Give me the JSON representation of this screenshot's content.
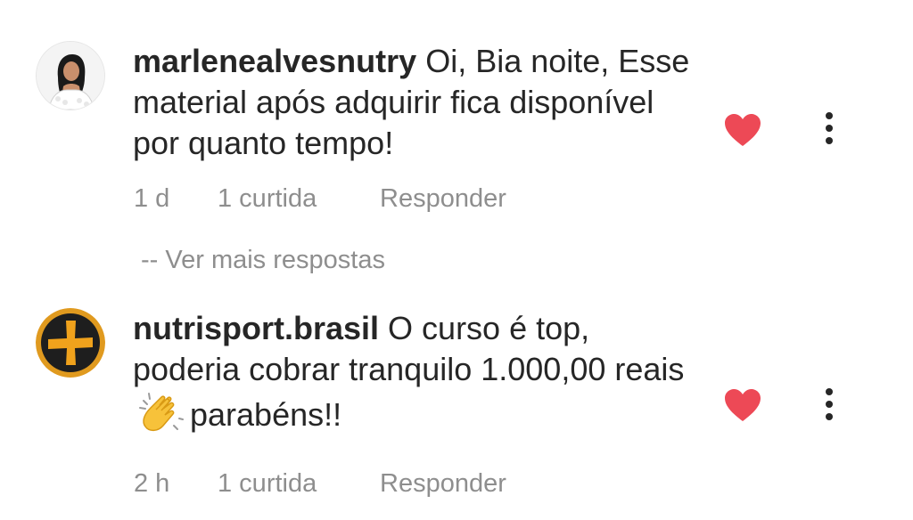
{
  "comments": [
    {
      "username": "marlenealvesnutry",
      "text": "Oi, Bia noite, Esse material após adquirir fica disponível por quanto tempo!",
      "time": "1 d",
      "likes": "1 curtida",
      "reply_label": "Responder",
      "avatar_icon": "profile-photo",
      "liked": true,
      "heart_color": "#ed4956"
    },
    {
      "username": "nutrisport.brasil",
      "text_before": "O curso é top, poderia cobrar tranquilo 1.000,00 reais",
      "text_after": "parabéns!!",
      "time": "2 h",
      "likes": "1 curtida",
      "reply_label": "Responder",
      "avatar_icon": "plus-logo",
      "liked": true,
      "heart_color": "#ed4956"
    }
  ],
  "view_more_replies": "-- Ver mais respostas"
}
